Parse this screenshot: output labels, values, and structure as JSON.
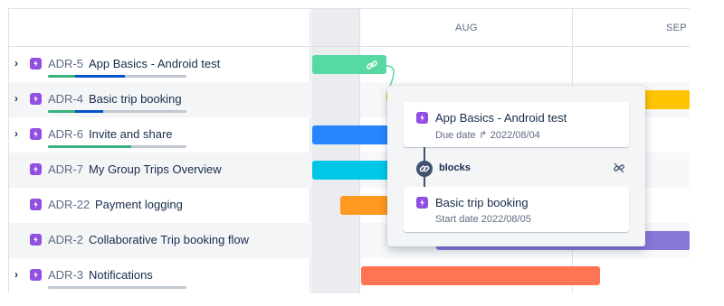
{
  "timeline": {
    "months": [
      "AUG",
      "SEP"
    ]
  },
  "issues": [
    {
      "key": "ADR-5",
      "title": "App Basics - Android test",
      "expandable": true,
      "progress": {
        "done": 0.2,
        "in_progress": 0.35
      }
    },
    {
      "key": "ADR-4",
      "title": "Basic trip booking",
      "expandable": true,
      "progress": {
        "done": 0.2,
        "in_progress": 0.2
      }
    },
    {
      "key": "ADR-6",
      "title": "Invite and share",
      "expandable": true,
      "progress": {
        "done": 0.6,
        "in_progress": 0.0
      }
    },
    {
      "key": "ADR-7",
      "title": "My Group Trips Overview",
      "expandable": false
    },
    {
      "key": "ADR-22",
      "title": "Payment logging",
      "expandable": false
    },
    {
      "key": "ADR-2",
      "title": "Collaborative Trip booking flow",
      "expandable": false
    },
    {
      "key": "ADR-3",
      "title": "Notifications",
      "expandable": true,
      "progress": {
        "done": 0.0,
        "in_progress": 0.0
      }
    }
  ],
  "colors": {
    "green": "#57d9a3",
    "blue": "#2684ff",
    "teal": "#00c7e6",
    "orange": "#ff991f",
    "purple": "#8777d9",
    "red": "#ff7452",
    "yellow": "#ffc400",
    "epic": "#904ee2"
  },
  "dependency_popover": {
    "source": {
      "title": "App Basics - Android test",
      "sub_label": "Due date",
      "sub_value": "2022/08/04"
    },
    "relation": "blocks",
    "target": {
      "title": "Basic trip booking",
      "sub_label": "Start date",
      "sub_value": "2022/08/05"
    },
    "icons": [
      "link-icon",
      "unlink-icon",
      "arrow-icon"
    ]
  }
}
